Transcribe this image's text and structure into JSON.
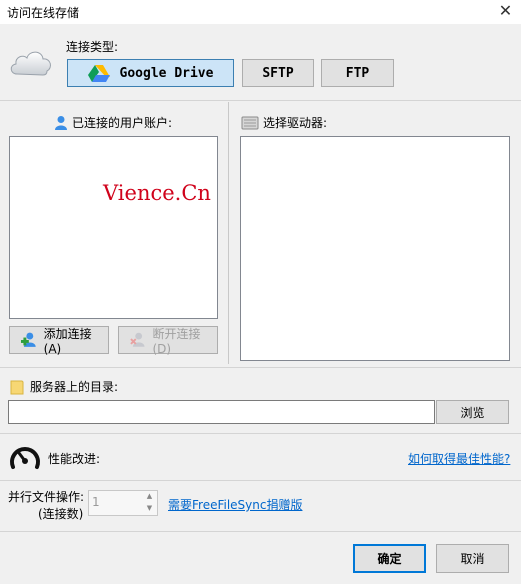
{
  "window": {
    "title": "访问在线存储",
    "close_glyph": "✕"
  },
  "connection": {
    "label": "连接类型:",
    "types": [
      {
        "label": "Google Drive",
        "selected": true
      },
      {
        "label": "SFTP",
        "selected": false
      },
      {
        "label": "FTP",
        "selected": false
      }
    ]
  },
  "accounts": {
    "label": "已连接的用户账户:",
    "add_button": "添加连接(A)",
    "disconnect_button": "断开连接(D)"
  },
  "drives": {
    "label": "选择驱动器:"
  },
  "watermark": "Vience.Cn",
  "directory": {
    "label": "服务器上的目录:",
    "value": "",
    "browse_button": "浏览"
  },
  "performance": {
    "label": "性能改进:",
    "link": "如何取得最佳性能?"
  },
  "parallel": {
    "label": "并行文件操作:",
    "sublabel": "(连接数)",
    "value": "1",
    "up_glyph": "▲",
    "down_glyph": "▼",
    "donate_link": "需要FreeFileSync捐赠版"
  },
  "footer": {
    "ok": "确定",
    "cancel": "取消"
  },
  "colors": {
    "accent": "#0078d7",
    "link": "#0066cc",
    "watermark": "#d0021b"
  }
}
